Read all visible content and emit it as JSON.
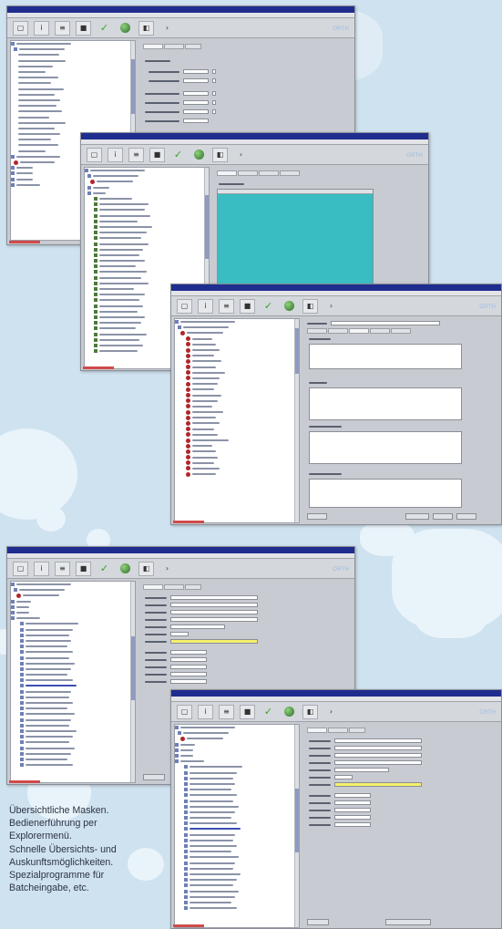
{
  "caption": {
    "lines": [
      "Übersichtliche Masken.",
      "Bedienerführung per",
      "Explorermenü.",
      "Schnelle Übersichts- und",
      "Auskunftsmöglichkeiten.",
      "Spezialprogramme für",
      "Batcheingabe, etc."
    ]
  },
  "brand": {
    "name": "ORTH",
    "suffix": "Informatik"
  },
  "icons": [
    "copy-icon",
    "info-icon",
    "settings-icon",
    "print-icon",
    "check-icon",
    "globe-icon",
    "camera-icon",
    "arrow-icon"
  ],
  "colors": {
    "titlebar": "#1f2d8f",
    "accent_teal": "#2fb8c0",
    "highlight": "#f5f06a",
    "background": "#cfe2ef"
  }
}
